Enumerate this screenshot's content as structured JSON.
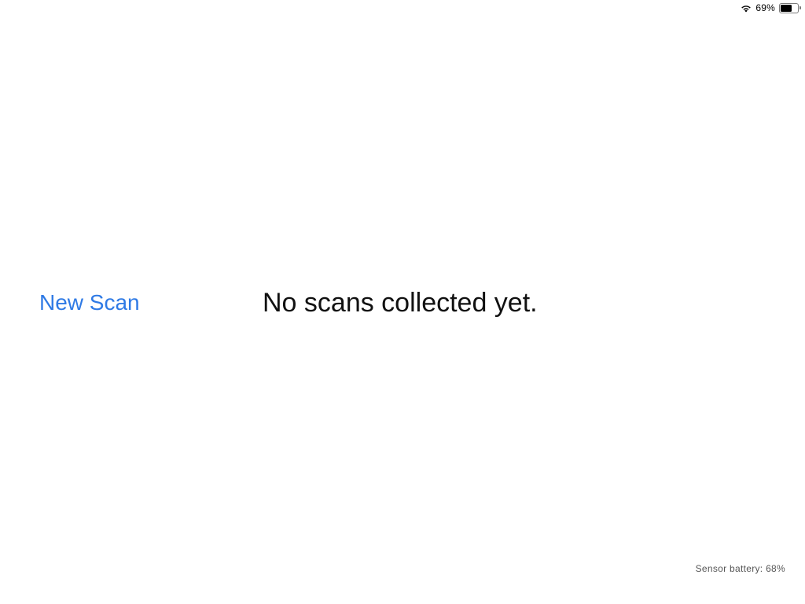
{
  "status_bar": {
    "wifi_icon": "wifi-icon",
    "battery_percent": "69%",
    "battery_level": 0.69,
    "battery_icon": "battery-icon"
  },
  "main": {
    "new_scan_label": "New Scan",
    "empty_message": "No scans collected yet."
  },
  "footer": {
    "sensor_battery": "Sensor battery: 68%"
  },
  "colors": {
    "accent": "#2f7ae5",
    "text": "#111111",
    "muted": "#555555",
    "background": "#ffffff"
  }
}
